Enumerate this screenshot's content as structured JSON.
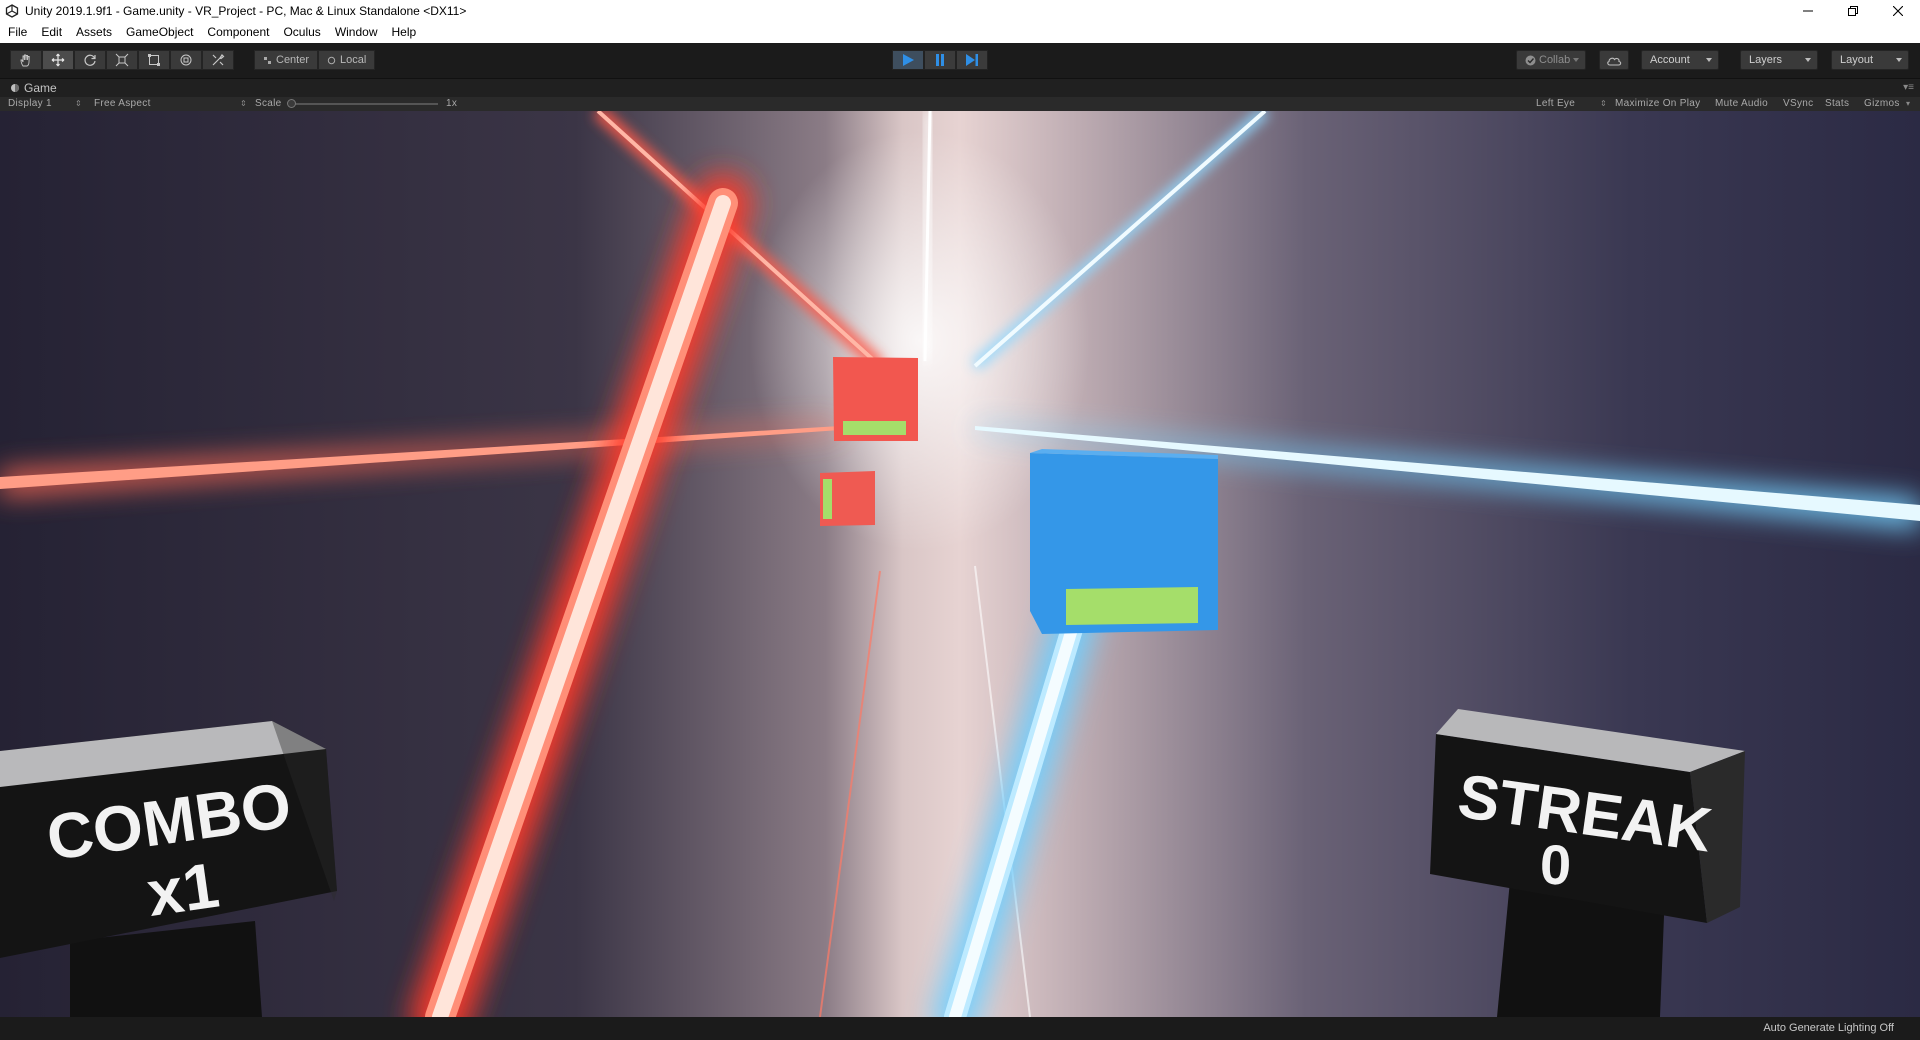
{
  "window": {
    "title": "Unity 2019.1.9f1 - Game.unity - VR_Project - PC, Mac & Linux Standalone <DX11>"
  },
  "menu": [
    "File",
    "Edit",
    "Assets",
    "GameObject",
    "Component",
    "Oculus",
    "Window",
    "Help"
  ],
  "toolbar": {
    "tools": [
      "hand-tool-icon",
      "move-tool-icon",
      "rotate-tool-icon",
      "scale-tool-icon",
      "rect-tool-icon",
      "transform-tool-icon",
      "custom-tool-icon"
    ],
    "pivot_label": "Center",
    "space_label": "Local",
    "collab_label": "Collab",
    "account_label": "Account",
    "layers_label": "Layers",
    "layout_label": "Layout"
  },
  "game_tab": {
    "label": "Game"
  },
  "game_controls": {
    "display": "Display 1",
    "aspect": "Free Aspect",
    "scale_label": "Scale",
    "scale_value": "1x",
    "eye": "Left Eye",
    "maximize": "Maximize On Play",
    "mute": "Mute Audio",
    "vsync": "VSync",
    "stats": "Stats",
    "gizmos": "Gizmos"
  },
  "scene": {
    "combo_title": "COMBO",
    "combo_value": "x1",
    "streak_title": "STREAK",
    "streak_value": "0"
  },
  "status": {
    "text": "Auto Generate Lighting Off"
  },
  "colors": {
    "red_beam": "#ff6a55",
    "blue_beam": "#9fe6ff",
    "red_cube": "#f2574f",
    "blue_cube": "#3497e8",
    "arrow_bar": "#a5de6a",
    "play_blue": "#2f8fe6"
  }
}
